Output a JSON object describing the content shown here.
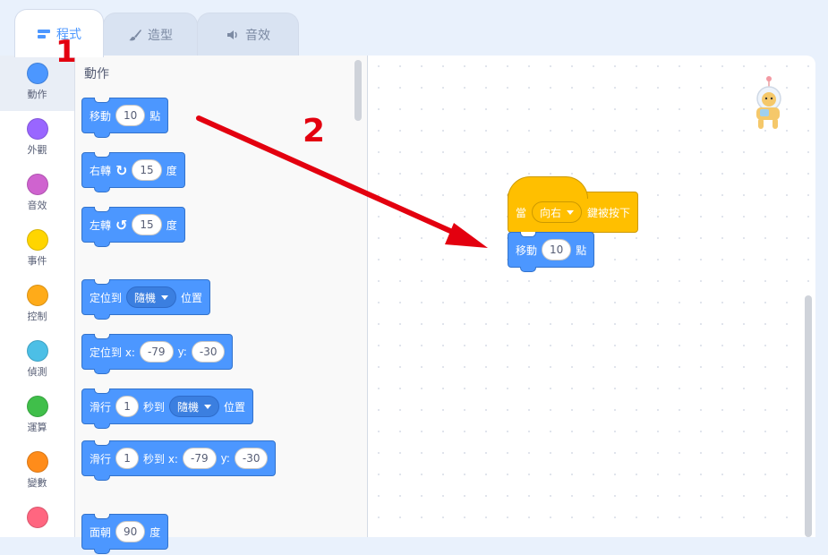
{
  "tabs": [
    {
      "label": "程式",
      "icon": "code-icon",
      "active": true
    },
    {
      "label": "造型",
      "icon": "paintbrush-icon",
      "active": false
    },
    {
      "label": "音效",
      "icon": "speaker-icon",
      "active": false
    }
  ],
  "categories": [
    {
      "label": "動作",
      "color": "#4c97ff"
    },
    {
      "label": "外觀",
      "color": "#9966ff"
    },
    {
      "label": "音效",
      "color": "#cf63cf"
    },
    {
      "label": "事件",
      "color": "#ffd500"
    },
    {
      "label": "控制",
      "color": "#ffab19"
    },
    {
      "label": "偵測",
      "color": "#4cbfe6"
    },
    {
      "label": "運算",
      "color": "#40bf4a"
    },
    {
      "label": "變數",
      "color": "#ff8c1a"
    },
    {
      "label": "",
      "color": "#ff6680"
    }
  ],
  "palette": {
    "title": "動作",
    "move": {
      "prefix": "移動",
      "value": "10",
      "suffix": "點"
    },
    "turn_right": {
      "prefix": "右轉",
      "value": "15",
      "suffix": "度"
    },
    "turn_left": {
      "prefix": "左轉",
      "value": "15",
      "suffix": "度"
    },
    "goto": {
      "prefix": "定位到",
      "option": "隨機",
      "suffix": "位置"
    },
    "goto_xy": {
      "prefix": "定位到 x:",
      "x": "-79",
      "ylabel": "y:",
      "y": "-30"
    },
    "glide": {
      "prefix": "滑行",
      "value": "1",
      "mid": "秒到",
      "option": "隨機",
      "suffix": "位置"
    },
    "glide_xy": {
      "prefix": "滑行",
      "value": "1",
      "mid": "秒到 x:",
      "x": "-79",
      "ylabel": "y:",
      "y": "-30"
    },
    "point": {
      "prefix": "面朝",
      "value": "90",
      "suffix": "度"
    }
  },
  "workspace": {
    "hat": {
      "prefix": "當",
      "option": "向右",
      "suffix": "鍵被按下"
    },
    "move": {
      "prefix": "移動",
      "value": "10",
      "suffix": "點"
    }
  },
  "annotations": {
    "step1": "1",
    "step2": "2",
    "arrow_color": "#e3000f"
  }
}
